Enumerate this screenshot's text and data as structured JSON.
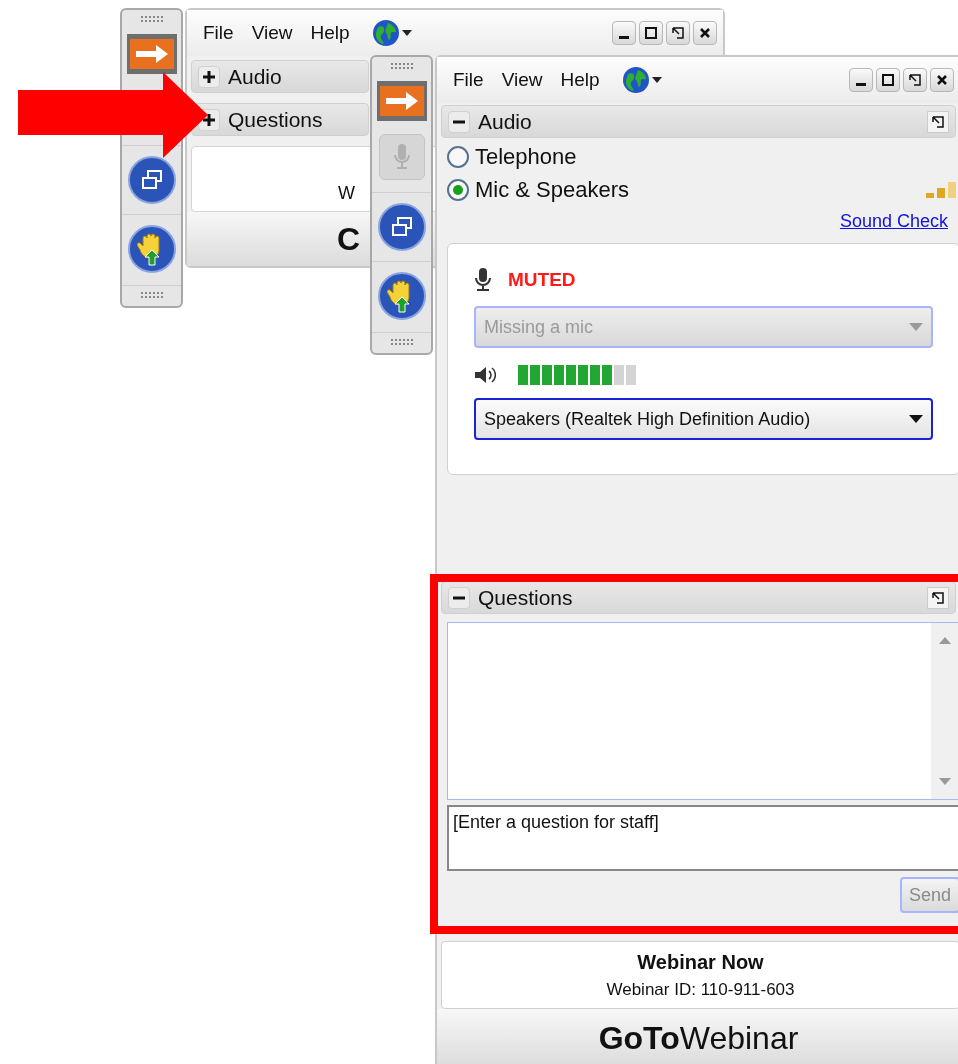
{
  "back_window": {
    "menu": [
      "File",
      "View",
      "Help"
    ],
    "panels": [
      {
        "title": "Audio",
        "expanded": false
      },
      {
        "title": "Questions",
        "expanded": false
      }
    ],
    "info_text": "W",
    "footer_text": "C"
  },
  "front_window": {
    "menu": [
      "File",
      "View",
      "Help"
    ],
    "audio": {
      "title": "Audio",
      "expanded": true,
      "options": [
        {
          "label": "Telephone",
          "selected": false
        },
        {
          "label": "Mic & Speakers",
          "selected": true
        }
      ],
      "sound_check": "Sound Check",
      "mic_status": "MUTED",
      "mic_select": {
        "value": "Missing a mic",
        "disabled": true
      },
      "speaker_meter": {
        "level": 0.8
      },
      "speaker_select": {
        "value": "Speakers (Realtek High Definition Audio)",
        "disabled": false
      }
    },
    "questions": {
      "title": "Questions",
      "expanded": true,
      "input": {
        "placeholder": "[Enter a question for staff]"
      },
      "send_button": {
        "label": "Send",
        "disabled": true
      }
    },
    "webinar": {
      "title": "Webinar Now",
      "id": "Webinar ID: 110-911-603"
    },
    "logo": "**GoTo**Webinar"
  }
}
